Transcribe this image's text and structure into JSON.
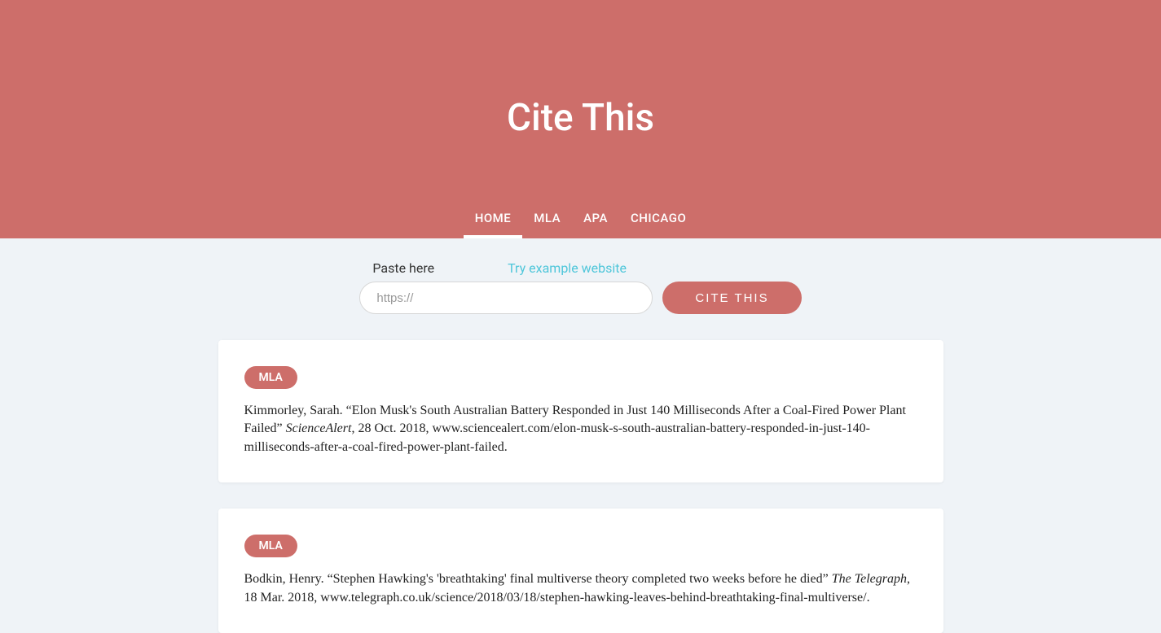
{
  "header": {
    "title": "Cite This"
  },
  "nav": {
    "items": [
      {
        "label": "HOME",
        "active": true
      },
      {
        "label": "MLA",
        "active": false
      },
      {
        "label": "APA",
        "active": false
      },
      {
        "label": "CHICAGO",
        "active": false
      }
    ]
  },
  "form": {
    "paste_label": "Paste here",
    "try_example_label": "Try example website",
    "input_placeholder": "https://",
    "cite_button": "CITE THIS"
  },
  "citations": [
    {
      "badge": "MLA",
      "author": "Kimmorley, Sarah.",
      "article_title": "“Elon Musk's South Australian Battery Responded in Just 140 Milliseconds After a Coal-Fired Power Plant Failed”",
      "source": "ScienceAlert",
      "rest": ", 28 Oct. 2018, www.sciencealert.com/elon-musk-s-south-australian-battery-responded-in-just-140-milliseconds-after-a-coal-fired-power-plant-failed."
    },
    {
      "badge": "MLA",
      "author": "Bodkin, Henry.",
      "article_title": "“Stephen Hawking's 'breathtaking' final multiverse theory completed two weeks before he died”",
      "source": "The Telegraph",
      "rest": ", 18 Mar. 2018, www.telegraph.co.uk/science/2018/03/18/stephen-hawking-leaves-behind-breathtaking-final-multiverse/."
    }
  ]
}
